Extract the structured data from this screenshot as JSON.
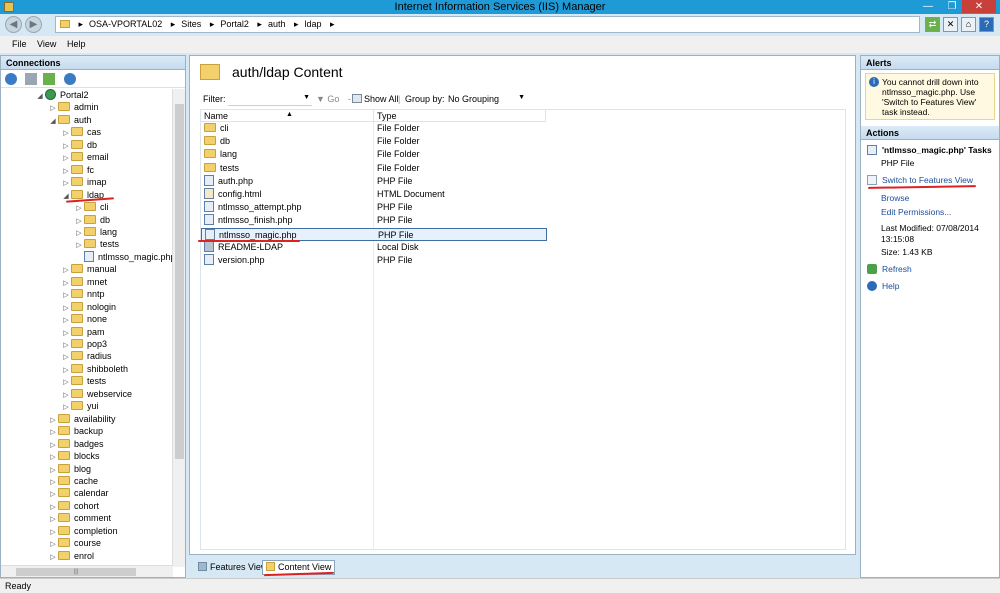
{
  "window": {
    "title": "Internet Information Services (IIS) Manager"
  },
  "address": {
    "segments": [
      "OSA-VPORTAL02",
      "Sites",
      "Portal2",
      "auth",
      "ldap"
    ]
  },
  "menu": {
    "file": "File",
    "view": "View",
    "help": "Help"
  },
  "connections": {
    "title": "Connections",
    "tree": [
      {
        "label": "Portal2",
        "kind": "globe",
        "level": 0,
        "exp": "◢"
      },
      {
        "label": "admin",
        "level": 1,
        "exp": "▷"
      },
      {
        "label": "auth",
        "level": 1,
        "exp": "◢"
      },
      {
        "label": "cas",
        "level": 2,
        "exp": "▷"
      },
      {
        "label": "db",
        "level": 2,
        "exp": "▷"
      },
      {
        "label": "email",
        "level": 2,
        "exp": "▷"
      },
      {
        "label": "fc",
        "level": 2,
        "exp": "▷"
      },
      {
        "label": "imap",
        "level": 2,
        "exp": "▷"
      },
      {
        "label": "ldap",
        "level": 2,
        "exp": "◢"
      },
      {
        "label": "cli",
        "level": 3,
        "exp": "▷"
      },
      {
        "label": "db",
        "level": 3,
        "exp": "▷"
      },
      {
        "label": "lang",
        "level": 3,
        "exp": "▷"
      },
      {
        "label": "tests",
        "level": 3,
        "exp": "▷"
      },
      {
        "label": "ntlmsso_magic.php",
        "kind": "php",
        "level": 3,
        "exp": ""
      },
      {
        "label": "manual",
        "level": 2,
        "exp": "▷"
      },
      {
        "label": "mnet",
        "level": 2,
        "exp": "▷"
      },
      {
        "label": "nntp",
        "level": 2,
        "exp": "▷"
      },
      {
        "label": "nologin",
        "level": 2,
        "exp": "▷"
      },
      {
        "label": "none",
        "level": 2,
        "exp": "▷"
      },
      {
        "label": "pam",
        "level": 2,
        "exp": "▷"
      },
      {
        "label": "pop3",
        "level": 2,
        "exp": "▷"
      },
      {
        "label": "radius",
        "level": 2,
        "exp": "▷"
      },
      {
        "label": "shibboleth",
        "level": 2,
        "exp": "▷"
      },
      {
        "label": "tests",
        "level": 2,
        "exp": "▷"
      },
      {
        "label": "webservice",
        "level": 2,
        "exp": "▷"
      },
      {
        "label": "yui",
        "level": 2,
        "exp": "▷"
      },
      {
        "label": "availability",
        "level": 1,
        "exp": "▷"
      },
      {
        "label": "backup",
        "level": 1,
        "exp": "▷"
      },
      {
        "label": "badges",
        "level": 1,
        "exp": "▷"
      },
      {
        "label": "blocks",
        "level": 1,
        "exp": "▷"
      },
      {
        "label": "blog",
        "level": 1,
        "exp": "▷"
      },
      {
        "label": "cache",
        "level": 1,
        "exp": "▷"
      },
      {
        "label": "calendar",
        "level": 1,
        "exp": "▷"
      },
      {
        "label": "cohort",
        "level": 1,
        "exp": "▷"
      },
      {
        "label": "comment",
        "level": 1,
        "exp": "▷"
      },
      {
        "label": "completion",
        "level": 1,
        "exp": "▷"
      },
      {
        "label": "course",
        "level": 1,
        "exp": "▷"
      },
      {
        "label": "enrol",
        "level": 1,
        "exp": "▷"
      }
    ]
  },
  "content": {
    "title": "auth/ldap Content",
    "filter_label": "Filter:",
    "go_label": "Go",
    "show_all_label": "Show All",
    "group_by_label": "Group by:",
    "group_by_value": "No Grouping",
    "col_name": "Name",
    "col_type": "Type",
    "rows": [
      {
        "name": "cli",
        "type": "File Folder",
        "icon": "folder"
      },
      {
        "name": "db",
        "type": "File Folder",
        "icon": "folder"
      },
      {
        "name": "lang",
        "type": "File Folder",
        "icon": "folder"
      },
      {
        "name": "tests",
        "type": "File Folder",
        "icon": "folder"
      },
      {
        "name": "auth.php",
        "type": "PHP File",
        "icon": "php"
      },
      {
        "name": "config.html",
        "type": "HTML Document",
        "icon": "html"
      },
      {
        "name": "ntlmsso_attempt.php",
        "type": "PHP File",
        "icon": "php"
      },
      {
        "name": "ntlmsso_finish.php",
        "type": "PHP File",
        "icon": "php"
      },
      {
        "name": "ntlmsso_magic.php",
        "type": "PHP File",
        "icon": "php",
        "selected": true
      },
      {
        "name": "README-LDAP",
        "type": "Local Disk",
        "icon": "disk"
      },
      {
        "name": "version.php",
        "type": "PHP File",
        "icon": "php"
      }
    ]
  },
  "viewtabs": {
    "features": "Features View",
    "content": "Content View"
  },
  "alerts": {
    "title": "Alerts",
    "message": "You cannot drill down into ntlmsso_magic.php. Use 'Switch to Features View' task instead."
  },
  "actions": {
    "title": "Actions",
    "tasks_title": "'ntlmsso_magic.php' Tasks",
    "file_type": "PHP File",
    "switch": "Switch to Features View",
    "browse": "Browse",
    "edit_permissions": "Edit Permissions...",
    "last_modified": "Last Modified: 07/08/2014",
    "time": "13:15:08",
    "size": "Size: 1.43 KB",
    "refresh": "Refresh",
    "help": "Help"
  },
  "status": {
    "text": "Ready"
  },
  "colors": {
    "titlebar": "#1e9bd7",
    "link": "#1a4d9c",
    "annotation": "#dd2222"
  }
}
